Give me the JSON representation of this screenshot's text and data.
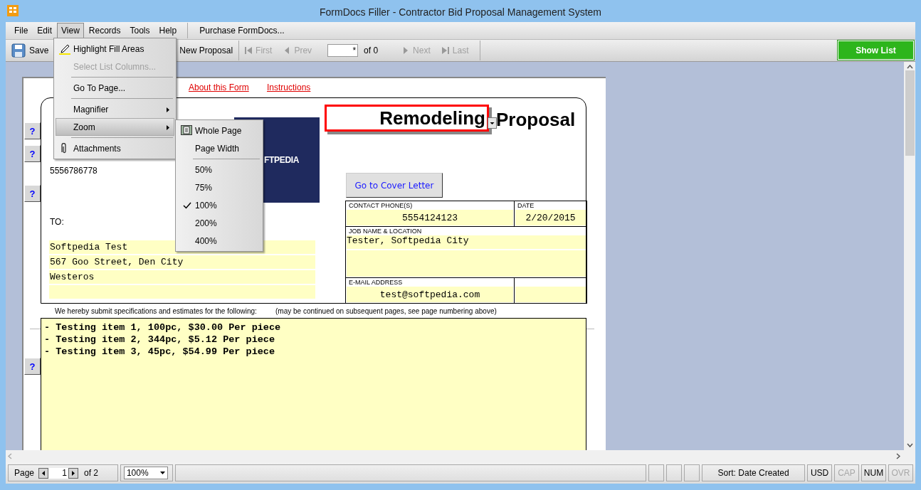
{
  "window": {
    "title": "FormDocs Filler - Contractor Bid Proposal Management System"
  },
  "menu_bar": {
    "items": [
      {
        "label": "File",
        "selected": false
      },
      {
        "label": "Edit",
        "selected": false
      },
      {
        "label": "View",
        "selected": true
      },
      {
        "label": "Records",
        "selected": false
      },
      {
        "label": "Tools",
        "selected": false
      },
      {
        "label": "Help",
        "selected": false
      }
    ],
    "purchase": "Purchase FormDocs..."
  },
  "toolbar": {
    "save": "Save",
    "new_proposal": "New Proposal",
    "record_field": "*",
    "record_count": "of 0",
    "show_list": "Show List",
    "nav": [
      {
        "kind": "first",
        "label": "First",
        "disabled": true
      },
      {
        "kind": "prev",
        "label": "Prev",
        "disabled": true
      },
      {
        "kind": "next",
        "label": "Next",
        "disabled": true
      },
      {
        "kind": "last",
        "label": "Last",
        "disabled": true
      }
    ]
  },
  "form": {
    "links": [
      "About this Form",
      "Instructions"
    ],
    "help_buttons": [
      "?",
      "?",
      "?",
      "?"
    ],
    "phone": "5556786778",
    "to_label": "TO:",
    "address_lines": [
      "Softpedia Test",
      "567 Goo Street, Den City",
      "Westeros"
    ],
    "logo_text": "FTPEDIA",
    "title_field": "Remodeling",
    "title_suffix": "Proposal",
    "cover_letter_button": "Go to Cover Letter",
    "contact_phone": {
      "label": "CONTACT PHONE(S)",
      "value": "5554124123"
    },
    "date": {
      "label": "DATE",
      "value": "2/20/2015"
    },
    "job": {
      "label": "JOB NAME & LOCATION",
      "value": "Tester, Softpedia City"
    },
    "email": {
      "label": "E-MAIL ADDRESS",
      "value": "test@softpedia.com"
    },
    "spec_intro": "We hereby submit specifications and estimates for the following:",
    "spec_note": "(may be continued on subsequent pages, see page numbering above)",
    "spec_lines": [
      "- Testing item 1, 100pc, $30.00 Per piece",
      "- Testing item 2, 344pc, $5.12 Per piece",
      "- Testing item 3, 45pc, $54.99 Per piece"
    ]
  },
  "view_menu": {
    "items": [
      {
        "kind": "item",
        "label": "Highlight Fill Areas",
        "disabled": false,
        "selected": false
      },
      {
        "kind": "item",
        "label": "Select List Columns...",
        "disabled": true,
        "selected": false
      },
      {
        "kind": "separator"
      },
      {
        "kind": "item",
        "label": "Go To Page...",
        "disabled": false,
        "selected": false
      },
      {
        "kind": "separator"
      },
      {
        "kind": "submenu",
        "label": "Magnifier",
        "disabled": false,
        "selected": false
      },
      {
        "kind": "submenu",
        "label": "Zoom",
        "disabled": false,
        "selected": true
      },
      {
        "kind": "separator"
      },
      {
        "kind": "item",
        "label": "Attachments",
        "disabled": false,
        "selected": false
      }
    ]
  },
  "zoom_menu": {
    "items": [
      {
        "kind": "item",
        "label": "Whole Page",
        "checked": false
      },
      {
        "kind": "item",
        "label": "Page Width",
        "checked": false
      },
      {
        "kind": "separator"
      },
      {
        "kind": "item",
        "label": "50%",
        "checked": false
      },
      {
        "kind": "item",
        "label": "75%",
        "checked": false
      },
      {
        "kind": "item",
        "label": "100%",
        "checked": true
      },
      {
        "kind": "item",
        "label": "200%",
        "checked": false
      },
      {
        "kind": "item",
        "label": "400%",
        "checked": false
      }
    ]
  },
  "status_bar": {
    "page_label": "Page",
    "page_field": "1",
    "page_count": "of 2",
    "zoom": "100%",
    "sort": "Sort: Date Created",
    "indicators": [
      {
        "label": "USD",
        "disabled": false
      },
      {
        "label": "CAP",
        "disabled": true
      },
      {
        "label": "NUM",
        "disabled": false
      },
      {
        "label": "OVR",
        "disabled": true
      }
    ]
  }
}
